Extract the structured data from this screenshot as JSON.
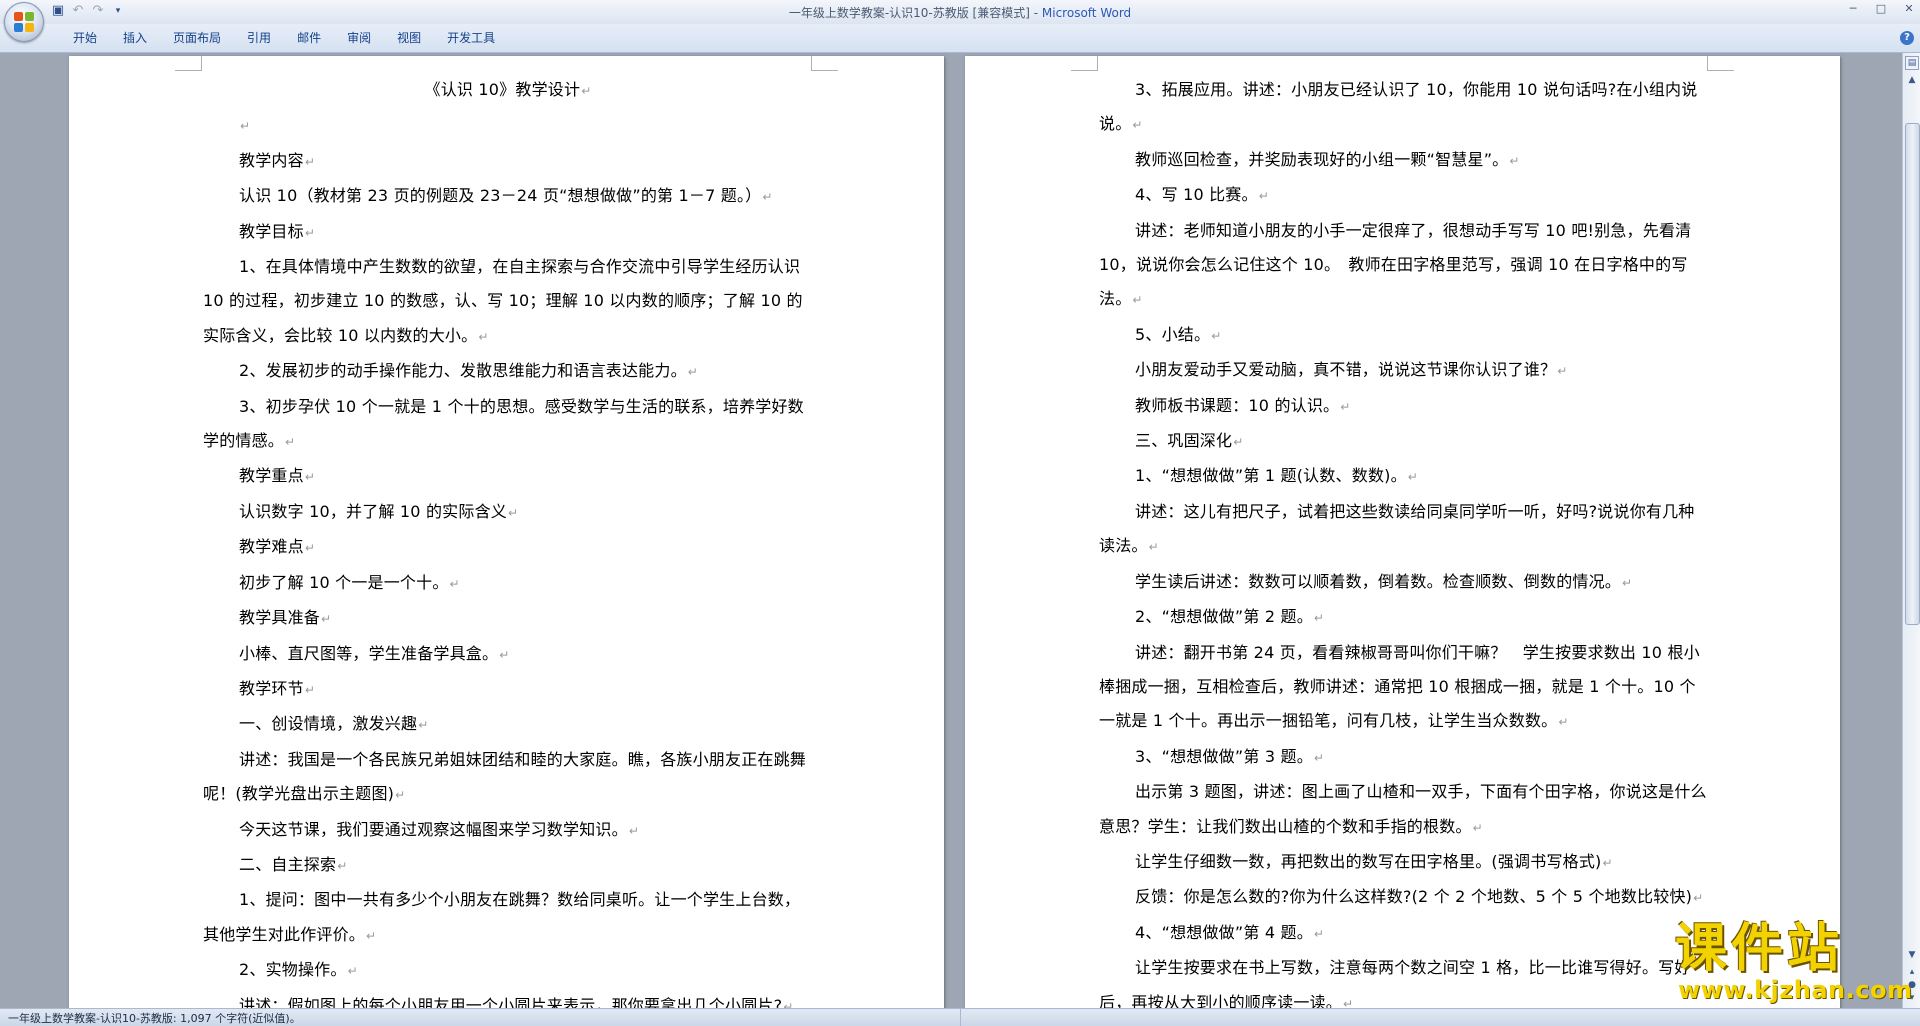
{
  "window": {
    "title_doc": "一年级上数学教案-认识10-苏教版 [兼容模式] - ",
    "title_app": "Microsoft Word"
  },
  "ribbon": {
    "tabs": [
      "开始",
      "插入",
      "页面布局",
      "引用",
      "邮件",
      "审阅",
      "视图",
      "开发工具"
    ]
  },
  "pages": {
    "left": [
      {
        "text": "《认识 10》教学设计",
        "center": true
      },
      {
        "text": "",
        "center": false
      },
      {
        "text": "教学内容"
      },
      {
        "text": "认识 10（教材第 23 页的例题及 23－24 页“想想做做”的第 1－7 题。）"
      },
      {
        "text": "教学目标"
      },
      {
        "text": "1、在具体情境中产生数数的欲望，在自主探索与合作交流中引导学生经历认识 10 的过程，初步建立 10 的数感，认、写 10；理解 10 以内数的顺序；了解 10 的实际含义，会比较 10 以内数的大小。"
      },
      {
        "text": "2、发展初步的动手操作能力、发散思维能力和语言表达能力。"
      },
      {
        "text": "3、初步孕伏 10 个一就是 1 个十的思想。感受数学与生活的联系，培养学好数学的情感。"
      },
      {
        "text": "教学重点"
      },
      {
        "text": "认识数字 10，并了解 10 的实际含义"
      },
      {
        "text": "教学难点"
      },
      {
        "text": "初步了解 10 个一是一个十。"
      },
      {
        "text": "教学具准备"
      },
      {
        "text": "小棒、直尺图等，学生准备学具盒。"
      },
      {
        "text": "教学环节"
      },
      {
        "text": "一、创设情境，激发兴趣"
      },
      {
        "text": "讲述：我国是一个各民族兄弟姐妹团结和睦的大家庭。瞧，各族小朋友正在跳舞呢！(教学光盘出示主题图)"
      },
      {
        "text": "今天这节课，我们要通过观察这幅图来学习数学知识。"
      },
      {
        "text": "二、自主探索"
      },
      {
        "text": "1、提问：图中一共有多少个小朋友在跳舞？数给同桌听。让一个学生上台数，其他学生对此作评价。"
      },
      {
        "text": "2、实物操作。"
      },
      {
        "text": "讲述：假如图上的每个小朋友用一个小圆片来表示，那你要拿出几个小圆片?"
      }
    ],
    "right": [
      {
        "text": "3、拓展应用。讲述：小朋友已经认识了 10，你能用 10 说句话吗?在小组内说说。"
      },
      {
        "text": "教师巡回检查，并奖励表现好的小组一颗“智慧星”。"
      },
      {
        "text": "4、写 10 比赛。"
      },
      {
        "text": "讲述：老师知道小朋友的小手一定很痒了，很想动手写写 10 吧!别急，先看清 10，说说你会怎么记住这个 10。　教师在田字格里范写，强调 10 在日字格中的写法。"
      },
      {
        "text": "5、小结。"
      },
      {
        "text": "小朋友爱动手又爱动脑，真不错，说说这节课你认识了谁？"
      },
      {
        "text": "教师板书课题：10 的认识。"
      },
      {
        "text": "三、巩固深化"
      },
      {
        "text": "1、“想想做做”第 1 题(认数、数数)。"
      },
      {
        "text": "讲述：这儿有把尺子，试着把这些数读给同桌同学听一听，好吗?说说你有几种读法。"
      },
      {
        "text": "学生读后讲述：数数可以顺着数，倒着数。检查顺数、倒数的情况。"
      },
      {
        "text": "2、“想想做做”第 2 题。"
      },
      {
        "text": "讲述：翻开书第 24 页，看看辣椒哥哥叫你们干嘛？　学生按要求数出 10 根小棒捆成一捆，互相检查后，教师讲述：通常把 10 根捆成一捆，就是 1 个十。10 个一就是 1 个十。再出示一捆铅笔，问有几枝，让学生当众数数。"
      },
      {
        "text": "3、“想想做做”第 3 题。"
      },
      {
        "text": "出示第 3 题图，讲述：图上画了山楂和一双手，下面有个田字格，你说这是什么意思？学生：让我们数出山楂的个数和手指的根数。"
      },
      {
        "text": "让学生仔细数一数，再把数出的数写在田字格里。(强调书写格式)"
      },
      {
        "text": "反馈：你是怎么数的?你为什么这样数?(2 个 2 个地数、5 个 5 个地数比较快)"
      },
      {
        "text": "4、“想想做做”第 4 题。"
      },
      {
        "text": "让学生按要求在书上写数，注意每两个数之间空 1 格，比一比谁写得好。写好后，再按从大到小的顺序读一读。"
      }
    ]
  },
  "status": {
    "text": "一年级上数学教案-认识10-苏教版: 1,097 个字符(近似值)。"
  },
  "watermark": {
    "cn": "课件站",
    "url": "www.kjzhan.com"
  },
  "icons": {
    "office": "office-button-icon",
    "save": "save-icon",
    "undo": "undo-icon",
    "redo": "redo-icon",
    "customize": "customize-qat-icon",
    "minimize": "minimize-icon",
    "maximize": "maximize-icon",
    "close": "close-icon",
    "help": "help-icon"
  },
  "colors": {
    "app_title": "#2c59b5",
    "ribbon_text": "#15428b",
    "workspace": "#9da6b2",
    "watermark": "#f2d200"
  }
}
